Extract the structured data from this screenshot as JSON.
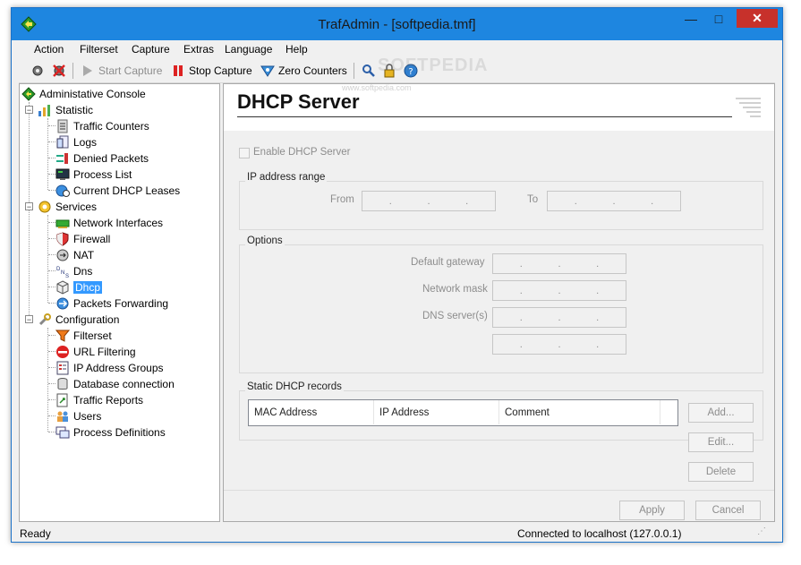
{
  "window": {
    "title": "TrafAdmin - [softpedia.tmf]",
    "min_glyph": "—",
    "max_glyph": "□",
    "close_glyph": "✕"
  },
  "menu": [
    "Action",
    "Filterset",
    "Capture",
    "Extras",
    "Language",
    "Help"
  ],
  "toolbar": {
    "start_capture": "Start Capture",
    "stop_capture": "Stop Capture",
    "zero_counters": "Zero Counters"
  },
  "tree": {
    "root": "Administative Console",
    "statistic": {
      "label": "Statistic",
      "items": [
        "Traffic Counters",
        "Logs",
        "Denied Packets",
        "Process List",
        "Current DHCP Leases"
      ]
    },
    "services": {
      "label": "Services",
      "items": [
        "Network Interfaces",
        "Firewall",
        "NAT",
        "Dns",
        "Dhcp",
        "Packets Forwarding"
      ]
    },
    "configuration": {
      "label": "Configuration",
      "items": [
        "Filterset",
        "URL Filtering",
        "IP Address Groups",
        "Database connection",
        "Traffic Reports",
        "Users",
        "Process Definitions"
      ]
    }
  },
  "page": {
    "title": "DHCP Server",
    "enable_label": "Enable DHCP Server",
    "ip_range": {
      "label": "IP address range",
      "from": "From",
      "to": "To"
    },
    "options": {
      "label": "Options",
      "gateway": "Default gateway",
      "mask": "Network mask",
      "dns": "DNS server(s)"
    },
    "static": {
      "label": "Static DHCP records",
      "columns": [
        "MAC Address",
        "IP Address",
        "Comment"
      ]
    },
    "buttons": {
      "add": "Add...",
      "edit": "Edit...",
      "delete": "Delete",
      "apply": "Apply",
      "cancel": "Cancel"
    },
    "ip_dot": "."
  },
  "status": {
    "left": "Ready",
    "right": "Connected to localhost (127.0.0.1)"
  },
  "watermark": {
    "big": "SOFTPEDIA",
    "small": "www.softpedia.com"
  },
  "colors": {
    "titlebar": "#1e86e0",
    "selection": "#3399ff",
    "close": "#c7312b"
  }
}
